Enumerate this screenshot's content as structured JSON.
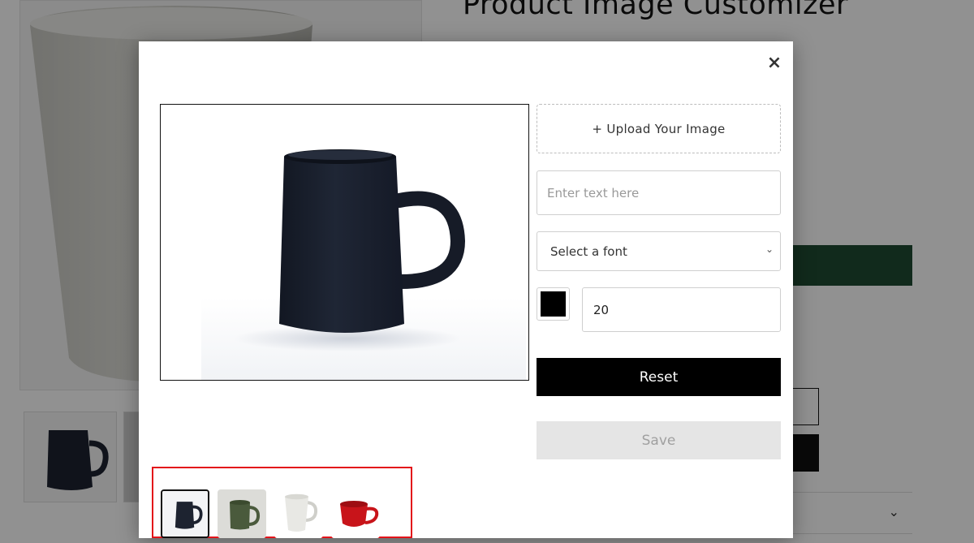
{
  "page": {
    "title": "Product Image Customizer"
  },
  "modal": {
    "close_label": "×",
    "upload_label": "+ Upload Your Image",
    "text_input": {
      "value": "",
      "placeholder": "Enter text here"
    },
    "font_select": {
      "selected": "Select a font"
    },
    "text_color": "#000000",
    "font_size": "20",
    "reset_label": "Reset",
    "save_label": "Save",
    "thumbnails": [
      {
        "name": "black-mug",
        "color": "#1d2330",
        "selected": true
      },
      {
        "name": "olive-mug",
        "color": "#4a5a3c",
        "selected": false
      },
      {
        "name": "white-mug",
        "color": "#e8e8e4",
        "selected": false
      },
      {
        "name": "red-mug",
        "color": "#c8141a",
        "selected": false
      }
    ]
  },
  "colors": {
    "overlay": "rgba(0,0,0,0.43)",
    "highlight_border": "#e3141a",
    "bg_accent_green": "#1e4a32"
  }
}
